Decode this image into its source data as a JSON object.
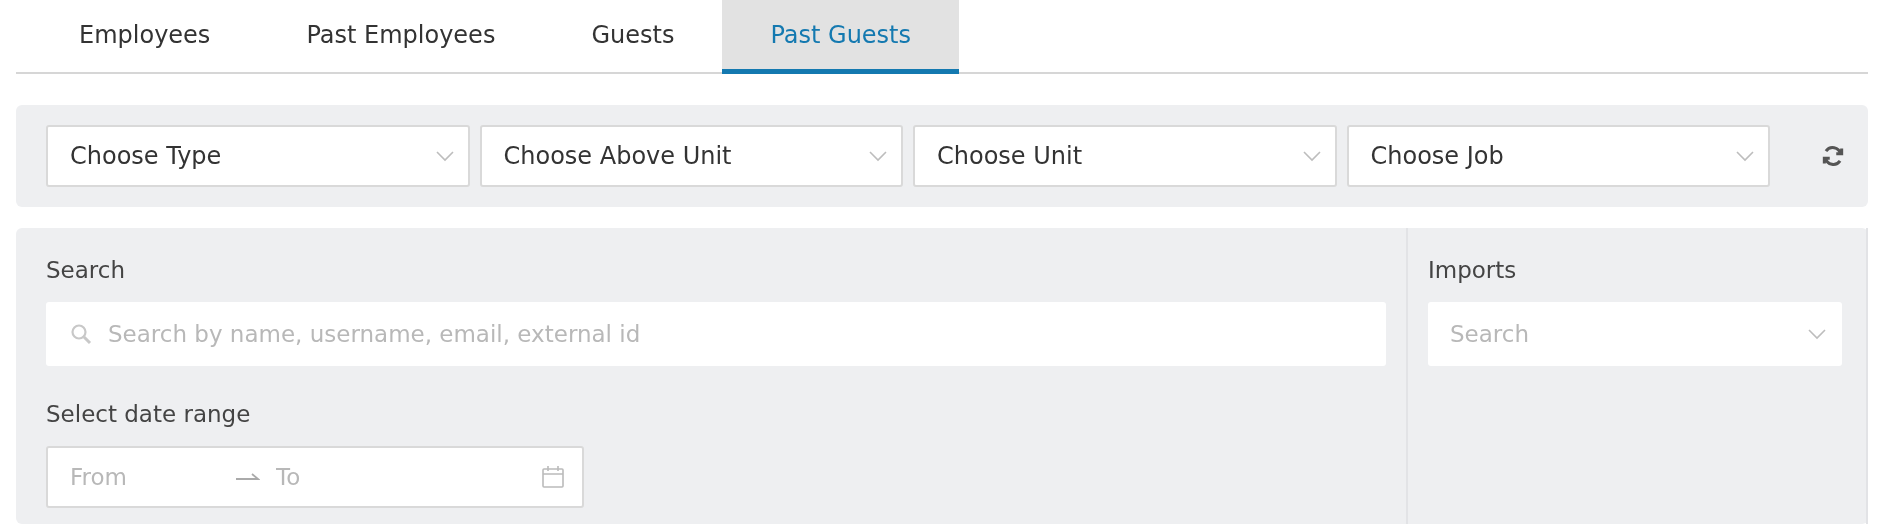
{
  "tabs": [
    {
      "label": "Employees",
      "selected": false
    },
    {
      "label": "Past Employees",
      "selected": false
    },
    {
      "label": "Guests",
      "selected": false
    },
    {
      "label": "Past Guests",
      "selected": true
    }
  ],
  "filters": [
    {
      "placeholder": "Choose Type"
    },
    {
      "placeholder": "Choose Above Unit"
    },
    {
      "placeholder": "Choose Unit"
    },
    {
      "placeholder": "Choose Job"
    }
  ],
  "search": {
    "label": "Search",
    "placeholder": "Search by name, username, email, external id"
  },
  "imports": {
    "label": "Imports",
    "placeholder": "Search"
  },
  "date_range": {
    "label": "Select date range",
    "from_placeholder": "From",
    "to_placeholder": "To"
  }
}
